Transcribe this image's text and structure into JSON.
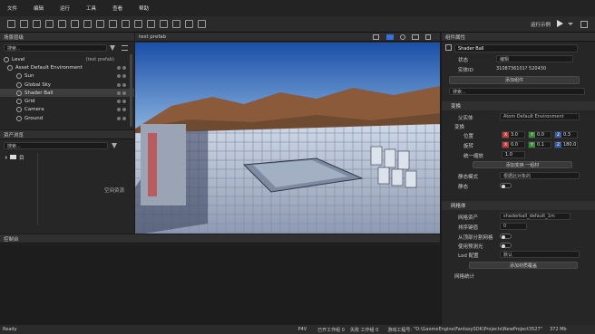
{
  "menu": [
    "文件",
    "编辑",
    "运行",
    "工具",
    "查看",
    "帮助"
  ],
  "toolbar": {
    "run_label": "运行示例"
  },
  "scene_panel": {
    "title": "场景层级",
    "search_placeholder": "搜索...",
    "items": [
      {
        "label": "Level",
        "extra": "(test prefab)"
      },
      {
        "label": "Asset Default Environment"
      },
      {
        "label": "Sun"
      },
      {
        "label": "Global Sky"
      },
      {
        "label": "Shader Ball"
      },
      {
        "label": "Grid"
      },
      {
        "label": "Camera"
      },
      {
        "label": "Ground"
      }
    ]
  },
  "asset_panel": {
    "title": "资产浏览",
    "search_placeholder": "搜索...",
    "folder": "目",
    "empty_text": "空间资源"
  },
  "viewport": {
    "tab": "test prefab"
  },
  "console": {
    "title": "控制台"
  },
  "properties": {
    "title": "组件属性",
    "entity_name": "Shader Ball",
    "state_label": "状态",
    "state_value": "编辑",
    "id_label": "实体ID",
    "id_value": "3108736101? 520430",
    "add_component": "添加组件",
    "search_placeholder": "搜索...",
    "transform": {
      "title": "变换",
      "space_label": "父实体",
      "space_value": "Atom Default Environment",
      "sub_title": "变换",
      "position_label": "位置",
      "rotation_label": "旋转",
      "scale_label": "统一缩放",
      "position": [
        "3.0",
        "0.0",
        "0.3"
      ],
      "rotation": [
        "0.0",
        "0.1",
        "180.0"
      ],
      "scale": "1.0",
      "add_btn": "添加变换 一组材",
      "mode_label": "静态模式",
      "mode_value": "根据此对象的",
      "lock_label": "静态"
    },
    "mesh": {
      "title": "网格体",
      "mesh_label": "网格资产",
      "mesh_value": "shaderball_default_1m",
      "sort_label": "排序键值",
      "sort_value": "0",
      "mip_label": "从顶部分割网格",
      "shadow_label": "使用预测光",
      "lod_label": "Lod 配置",
      "lod_value": "默认",
      "add_btn": "添加材质覆盖",
      "footer": "网格统计"
    }
  },
  "status": {
    "left": "Ready",
    "p": "P4V",
    "work1": "已开工作组 0",
    "work2": "失败 工作组 0",
    "path_prefix": "游戏工程号:",
    "path": "\"D:\\GaomeEngine\\FantasySDK\\Projects\\NewProject3527\"",
    "mem": "372 Mb"
  },
  "colors": {
    "accent": "#3a6fd8",
    "bg": "#1b1b1b"
  }
}
